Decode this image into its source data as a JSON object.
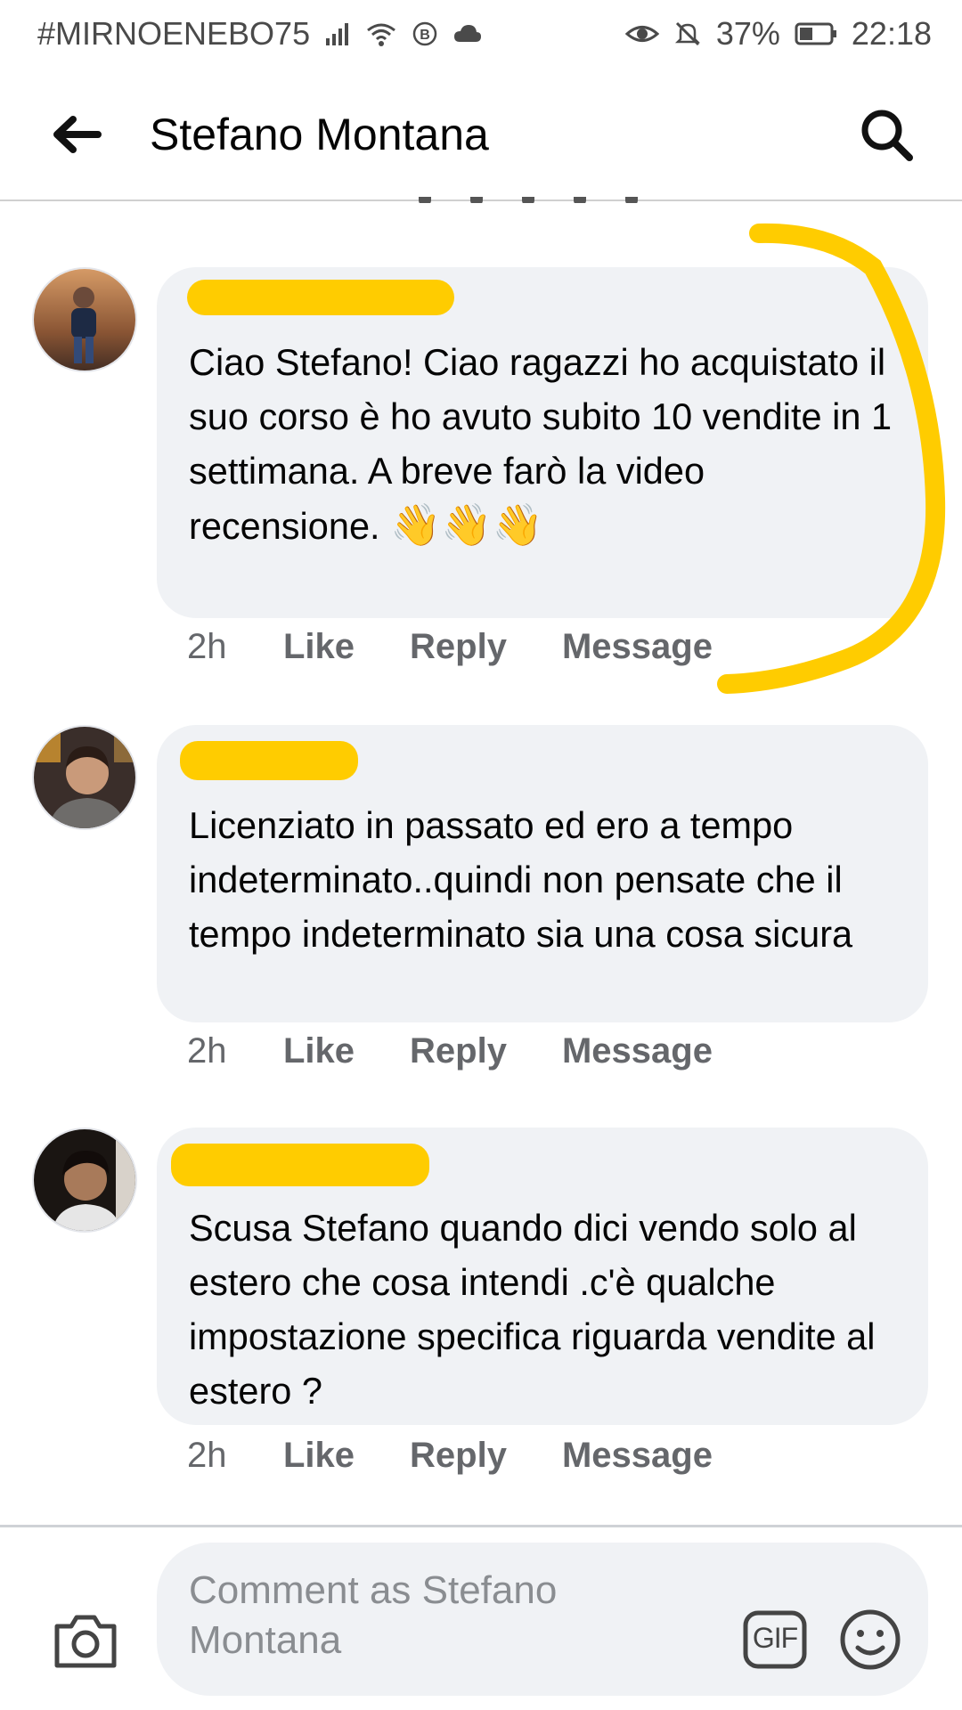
{
  "status_bar": {
    "carrier": "#MIRNOENEBO75",
    "battery": "37%",
    "time": "22:18",
    "icons": [
      "signal-icon",
      "wifi-icon",
      "b-icon",
      "cloud-icon",
      "eye-icon",
      "bell-off-icon",
      "battery-icon"
    ]
  },
  "header": {
    "title": "Stefano Montana",
    "back_icon": "arrow-left-icon",
    "search_icon": "search-icon"
  },
  "comments": [
    {
      "text": "Ciao Stefano! Ciao ragazzi ho acquistato il suo corso è ho avuto subito 10 vendite in 1 settimana. A breve farò la video recensione.",
      "emoji": "👋👋👋",
      "time": "2h",
      "like": "Like",
      "reply": "Reply",
      "message": "Message"
    },
    {
      "text": "Licenziato in passato ed ero a tempo indeterminato..quindi non pensate che il tempo indeterminato sia una cosa sicura",
      "time": "2h",
      "like": "Like",
      "reply": "Reply",
      "message": "Message"
    },
    {
      "text": "Scusa Stefano quando dici vendo solo al estero che cosa intendi .c'è qualche impostazione specifica riguarda vendite al estero ?",
      "time": "2h",
      "like": "Like",
      "reply": "Reply",
      "message": "Message"
    }
  ],
  "composer": {
    "placeholder": "Comment as Stefano Montana",
    "gif_label": "GIF",
    "camera_icon": "camera-icon",
    "emoji_icon": "smiley-icon"
  },
  "colors": {
    "marker": "#ffcc00",
    "bubble": "#f0f2f5",
    "secondary_text": "#65676b"
  }
}
